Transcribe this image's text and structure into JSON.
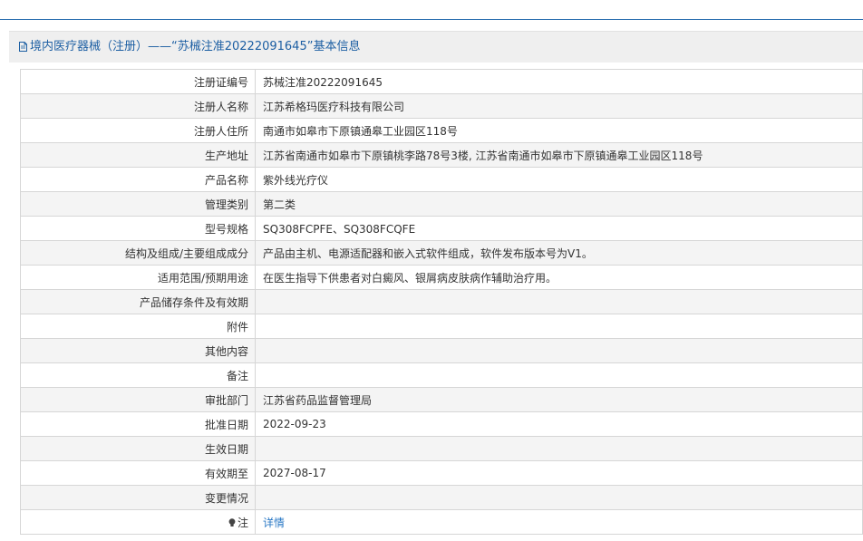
{
  "header": {
    "title": "境内医疗器械（注册）——“苏械注准20222091645”基本信息"
  },
  "rows": [
    {
      "label": "注册证编号",
      "value": "苏械注准20222091645"
    },
    {
      "label": "注册人名称",
      "value": "江苏希格玛医疗科技有限公司"
    },
    {
      "label": "注册人住所",
      "value": "南通市如皋市下原镇通皋工业园区118号"
    },
    {
      "label": "生产地址",
      "value": "江苏省南通市如皋市下原镇桃李路78号3楼, 江苏省南通市如皋市下原镇通皋工业园区118号"
    },
    {
      "label": "产品名称",
      "value": "紫外线光疗仪"
    },
    {
      "label": "管理类别",
      "value": "第二类"
    },
    {
      "label": "型号规格",
      "value": "SQ308FCPFE、SQ308FCQFE"
    },
    {
      "label": "结构及组成/主要组成成分",
      "value": "产品由主机、电源适配器和嵌入式软件组成，软件发布版本号为V1。"
    },
    {
      "label": "适用范围/预期用途",
      "value": "在医生指导下供患者对白癜风、银屑病皮肤病作辅助治疗用。"
    },
    {
      "label": "产品储存条件及有效期",
      "value": ""
    },
    {
      "label": "附件",
      "value": ""
    },
    {
      "label": "其他内容",
      "value": ""
    },
    {
      "label": "备注",
      "value": ""
    },
    {
      "label": "审批部门",
      "value": "江苏省药品监督管理局"
    },
    {
      "label": "批准日期",
      "value": "2022-09-23"
    },
    {
      "label": "生效日期",
      "value": ""
    },
    {
      "label": "有效期至",
      "value": "2027-08-17"
    },
    {
      "label": "变更情况",
      "value": ""
    }
  ],
  "note_row": {
    "label": "注",
    "icon": "lightbulb-icon",
    "link_text": "详情"
  },
  "colors": {
    "accent": "#1d5fa3",
    "link": "#2a78c5",
    "border": "#d6d6d6",
    "stripe": "#f4f4f4"
  }
}
